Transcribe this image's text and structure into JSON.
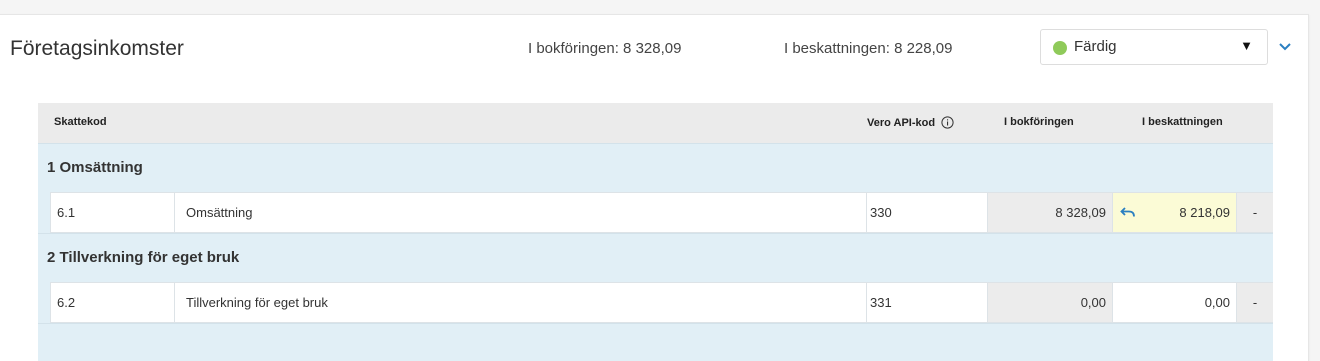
{
  "header": {
    "title": "Företagsinkomster",
    "book_summary": "I bokföringen: 8 328,09",
    "tax_summary": "I beskattningen: 8 228,09"
  },
  "status": {
    "label": "Färdig",
    "color": "#8fca5a",
    "icon": "chevron-down-icon"
  },
  "table": {
    "headers": {
      "code": "Skattekod",
      "api": "Vero API-kod",
      "book": "I bokföringen",
      "tax": "I beskattningen"
    },
    "groups": [
      {
        "label": "1 Omsättning",
        "rows": [
          {
            "code": "6.1",
            "name": "Omsättning",
            "api": "330",
            "book": "8 328,09",
            "tax": "8 218,09",
            "extra": "-",
            "changed": true
          }
        ]
      },
      {
        "label": "2 Tillverkning för eget bruk",
        "rows": [
          {
            "code": "6.2",
            "name": "Tillverkning för eget bruk",
            "api": "331",
            "book": "0,00",
            "tax": "0,00",
            "extra": "-",
            "changed": false
          }
        ]
      }
    ]
  },
  "colors": {
    "accent": "#2a7fc1",
    "group_bg": "#e1eff6",
    "changed_bg": "#fbfbd6"
  }
}
